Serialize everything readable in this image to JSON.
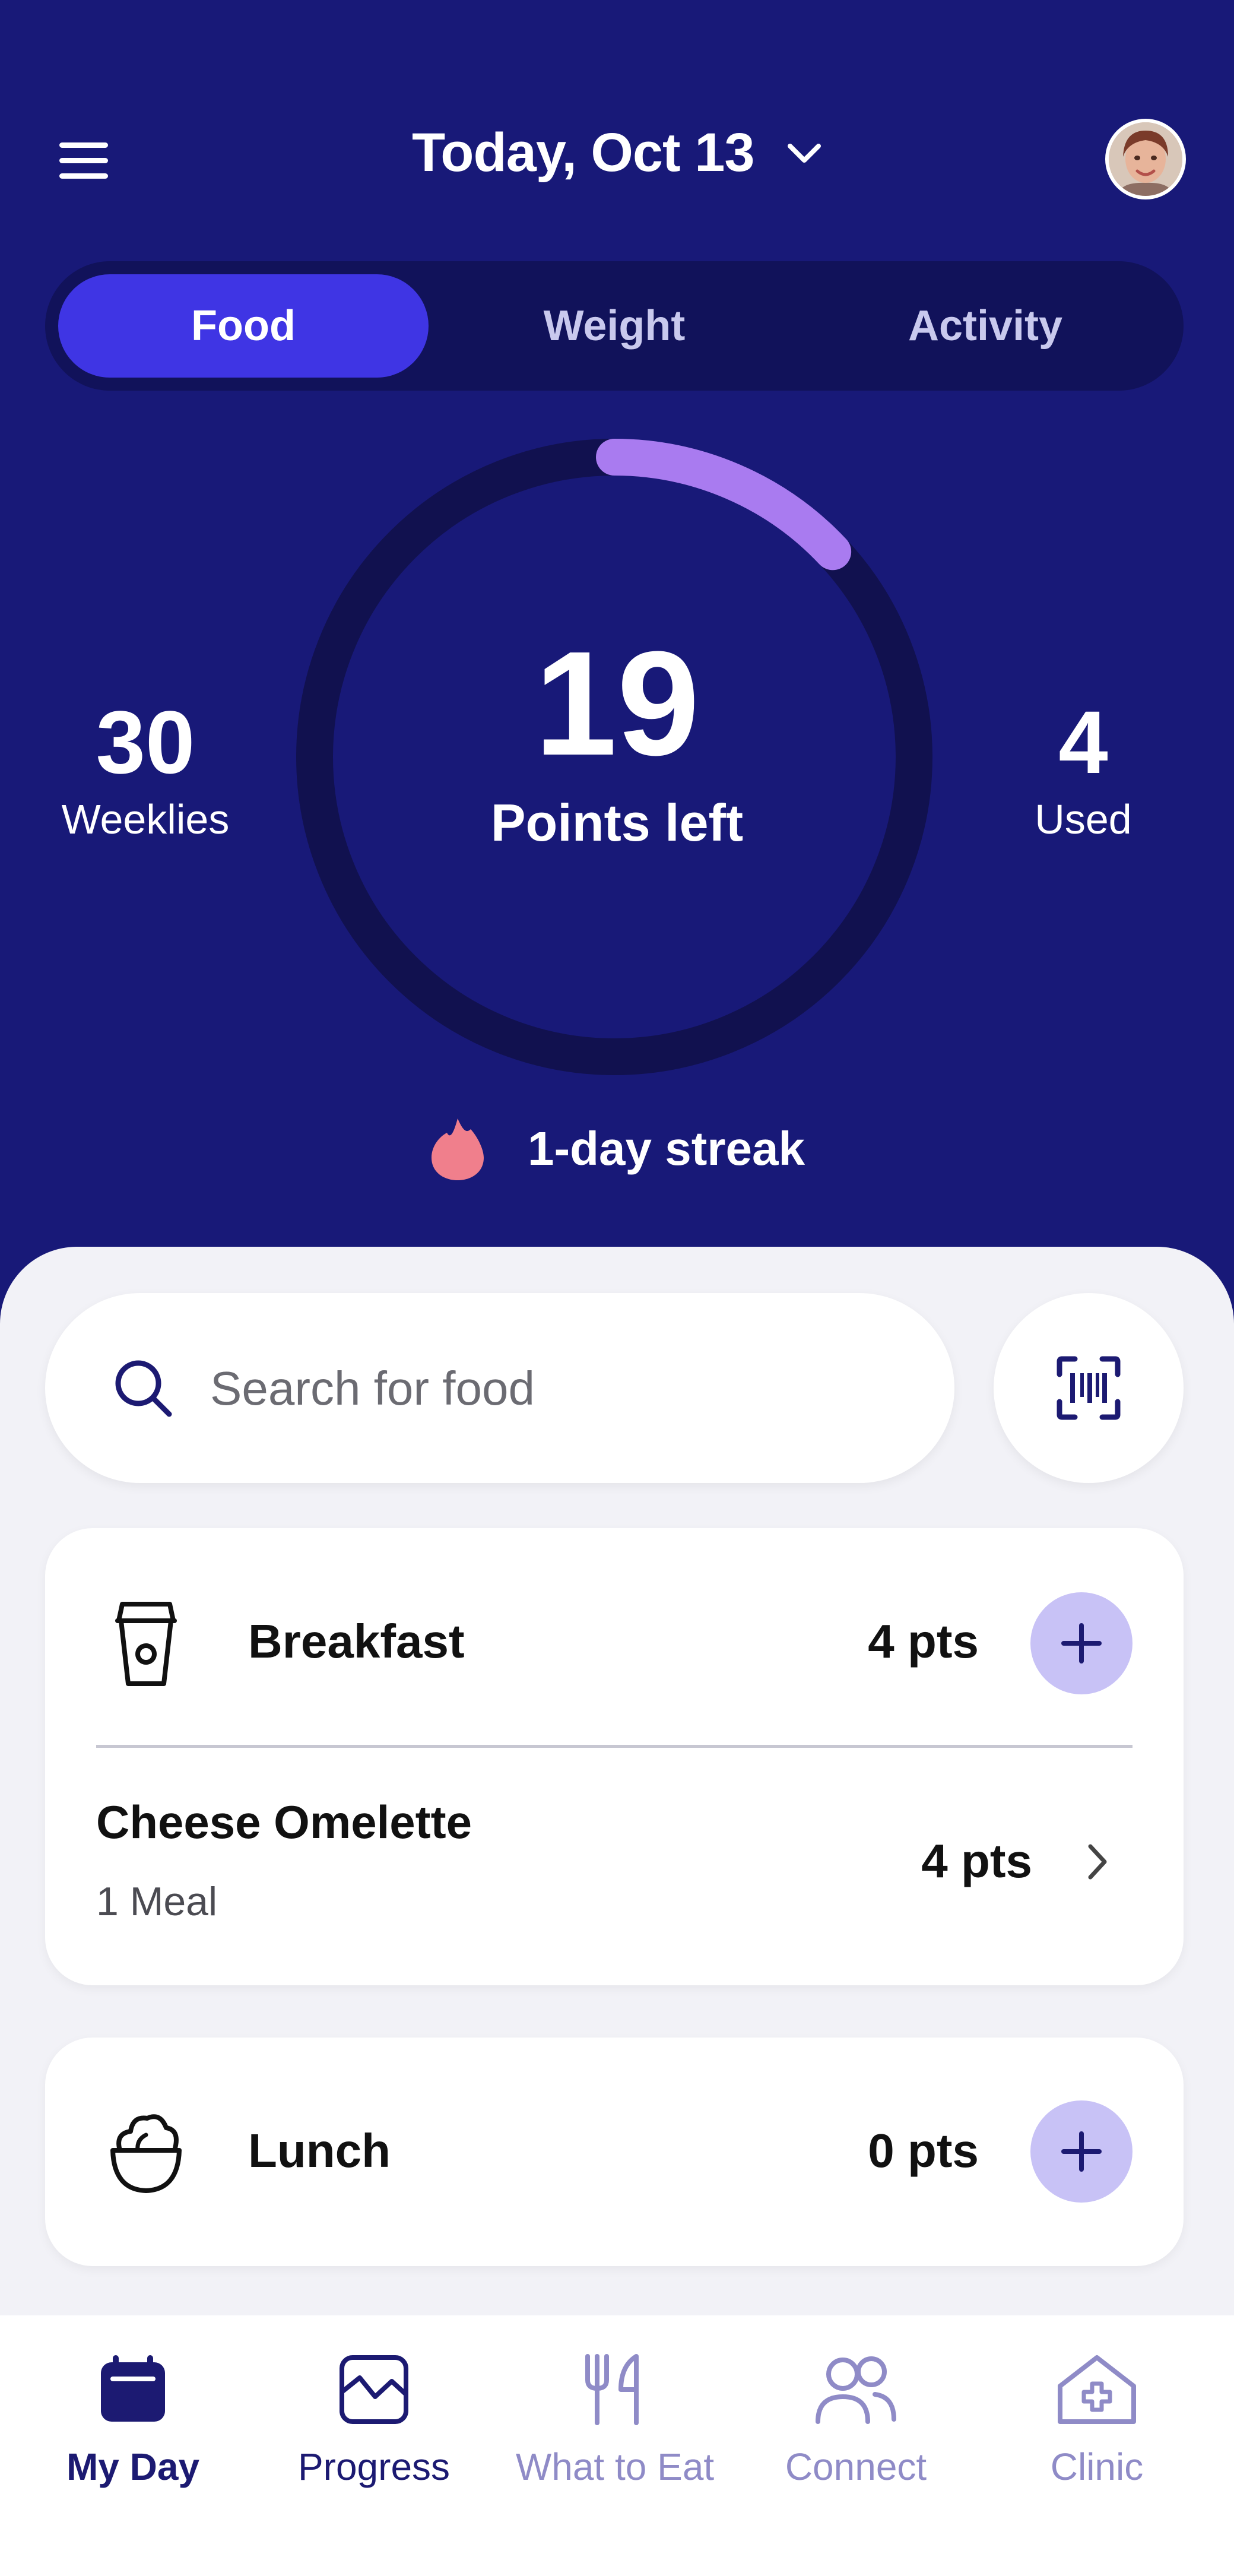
{
  "header": {
    "date": "Today, Oct 13",
    "menu_icon": "hamburger-icon",
    "avatar_icon": "profile-avatar"
  },
  "tabs": [
    {
      "label": "Food",
      "active": true
    },
    {
      "label": "Weight",
      "active": false
    },
    {
      "label": "Activity",
      "active": false
    }
  ],
  "summary": {
    "weeklies_value": "30",
    "weeklies_label": "Weeklies",
    "points_left_value": "19",
    "points_left_label": "Points left",
    "used_value": "4",
    "used_label": "Used",
    "ring_progress_fraction": 0.13,
    "streak": "1-day streak"
  },
  "search": {
    "placeholder": "Search for food",
    "barcode_icon": "barcode-scan-icon"
  },
  "meals": [
    {
      "title": "Breakfast",
      "points": "4 pts",
      "icon": "coffee-cup-icon",
      "items": [
        {
          "title": "Cheese Omelette",
          "subtitle": "1 Meal",
          "points": "4 pts"
        }
      ]
    },
    {
      "title": "Lunch",
      "points": "0 pts",
      "icon": "salad-bowl-icon",
      "items": []
    }
  ],
  "nav": [
    {
      "label": "My Day",
      "icon": "calendar-icon",
      "active": true
    },
    {
      "label": "Progress",
      "icon": "chart-icon",
      "active": false
    },
    {
      "label": "What to Eat",
      "icon": "fork-knife-icon",
      "active": false
    },
    {
      "label": "Connect",
      "icon": "people-icon",
      "active": false
    },
    {
      "label": "Clinic",
      "icon": "clinic-icon",
      "active": false
    }
  ],
  "colors": {
    "hero_bg": "#181978",
    "active_tab": "#3f35e4",
    "ring_progress": "#a97bf0",
    "streak_flame": "#f07f8c",
    "add_button": "#c8c2f6",
    "nav_active": "#1c1a72",
    "nav_inactive": "#8f8bc7"
  }
}
